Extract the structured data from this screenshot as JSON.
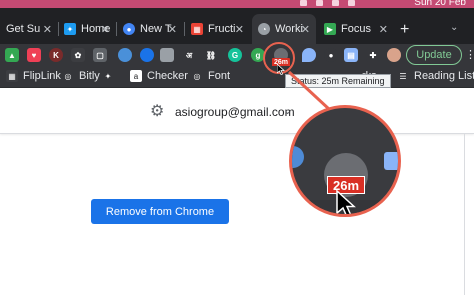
{
  "menubar": {
    "clock": "Sun 20 Feb",
    "background": "#c44a73"
  },
  "tabs": [
    {
      "title": "Get Su",
      "favicon": "partial-tab-icon",
      "color": "#5f6368",
      "active": false
    },
    {
      "title": "Home",
      "favicon": "twitter-icon",
      "color": "#1d9bf0",
      "active": false
    },
    {
      "title": "New T",
      "favicon": "water-drop-icon",
      "color": "#4285f4",
      "active": false
    },
    {
      "title": "Fructi",
      "favicon": "calendar-icon",
      "color": "#ea4335",
      "active": false
    },
    {
      "title": "Worki",
      "favicon": "timer-icon",
      "color": "#9aa0a6",
      "active": true
    },
    {
      "title": "Focus",
      "favicon": "play-icon",
      "color": "#34a853",
      "active": false
    }
  ],
  "toolbar": {
    "update_label": "Update",
    "extensions": [
      {
        "name": "drive-icon",
        "color": "#34a853",
        "glyph": ""
      },
      {
        "name": "pocket-icon",
        "color": "#ef4056",
        "glyph": "♥"
      },
      {
        "name": "k-extension-icon",
        "color": "#7a2b2b",
        "glyph": "K"
      },
      {
        "name": "flower-icon",
        "color": "#3c3d41",
        "glyph": "✿"
      },
      {
        "name": "frame-icon",
        "color": "#5f6368",
        "glyph": "▢"
      },
      {
        "name": "chat-bubble-icon",
        "color": "#4a90d9",
        "glyph": "●"
      },
      {
        "name": "blue-dot-icon",
        "color": "#1a73e8",
        "glyph": "●"
      },
      {
        "name": "square-icon",
        "color": "#9aa0a6",
        "glyph": "■"
      },
      {
        "name": "hindi-script-icon",
        "color": "#35363a",
        "glyph": "अ"
      },
      {
        "name": "link-icon",
        "color": "#35363a",
        "glyph": "⛓"
      },
      {
        "name": "grammarly-icon",
        "color": "#15c39a",
        "glyph": "G"
      },
      {
        "name": "g-circle-icon",
        "color": "#34a853",
        "glyph": "g"
      }
    ],
    "timer_extension_badge": "26m",
    "trailing_extensions": [
      {
        "name": "blue-drop-icon",
        "color": "#8ab4f8",
        "glyph": "◆"
      },
      {
        "name": "bomb-icon",
        "color": "#35363a",
        "glyph": "●"
      },
      {
        "name": "note-icon",
        "color": "#8ab4f8",
        "glyph": "▤"
      },
      {
        "name": "puzzle-icon",
        "color": "#35363a",
        "glyph": "✚"
      },
      {
        "name": "profile-avatar-icon",
        "color": "#d9a38b",
        "glyph": ""
      }
    ]
  },
  "bookmarks": [
    {
      "label": "FlipLink",
      "icon": "fliplink-icon",
      "color": "#3c3d41",
      "glyph": "▦"
    },
    {
      "label": "Bitly",
      "icon": "globe-icon",
      "color": "#35363a",
      "glyph": "◎"
    },
    {
      "label": "",
      "icon": "star-bookmark-icon",
      "color": "#35363a",
      "glyph": "✦"
    },
    {
      "label": "Checker",
      "icon": "amazon-icon",
      "color": "#ffffff",
      "glyph": "a"
    },
    {
      "label": "Font",
      "icon": "font-icon",
      "color": "#35363a",
      "glyph": "◎"
    },
    {
      "label": "rks",
      "icon": "bookmark-icon",
      "color": "#35363a",
      "glyph": ""
    },
    {
      "label": "Reading List",
      "icon": "reading-list-icon",
      "color": "#35363a",
      "glyph": "☰"
    }
  ],
  "tooltip": "Status: 25m Remaining",
  "page": {
    "account_email": "asiogroup@gmail.com",
    "remove_button": "Remove from Chrome"
  },
  "zoom": {
    "badge": "26m",
    "ring_color": "#e8624f"
  }
}
